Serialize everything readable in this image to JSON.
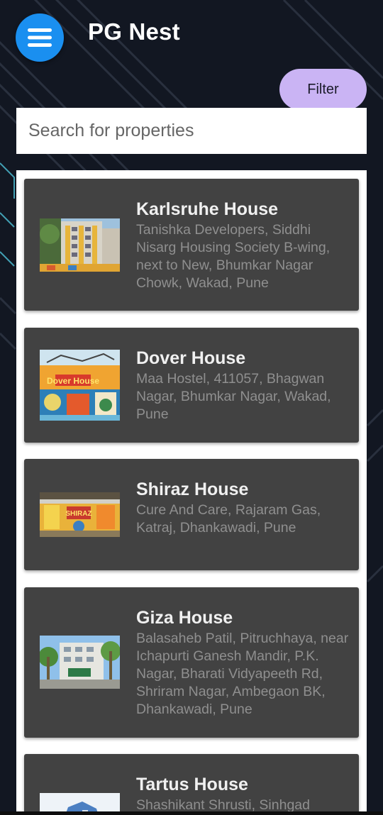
{
  "app": {
    "title": "PG Nest"
  },
  "header": {
    "menu_icon": "hamburger-menu-icon",
    "filter_label": "Filter"
  },
  "search": {
    "placeholder": "Search for properties",
    "value": ""
  },
  "colors": {
    "menu_button": "#1a8ff0",
    "filter_button": "#cab4f4",
    "card_background": "#424242",
    "page_background": "#121722",
    "address_text": "#8f8f8f"
  },
  "properties": [
    {
      "name": "Karlsruhe House",
      "address": "Tanishka Developers, Siddhi Nisarg Housing Society B-wing, next to New, Bhumkar Nagar Chowk, Wakad, Pune",
      "image": "apartment-building-photo"
    },
    {
      "name": "Dover House",
      "address": "Maa Hostel, 411057, Bhagwan Nagar, Bhumkar Nagar, Wakad, Pune",
      "image": "dover-house-mural-photo",
      "image_text": "Dover House"
    },
    {
      "name": "Shiraz House",
      "address": "Cure And Care, Rajaram Gas, Katraj, Dhankawadi, Pune",
      "image": "shiraz-mural-photo",
      "image_text": "SHIRAZ"
    },
    {
      "name": "Giza House",
      "address": "Balasaheb Patil, Pitruchhaya, near Ichapurti Ganesh Mandir, P.K. Nagar, Bharati Vidyapeeth Rd, Shriram Nagar, Ambegaon BK, Dhankawadi, Pune",
      "image": "building-with-palm-trees-photo"
    },
    {
      "name": "Tartus House",
      "address": "Shashikant Shrusti, Sinhgad",
      "image": "blue-building-photo"
    }
  ]
}
